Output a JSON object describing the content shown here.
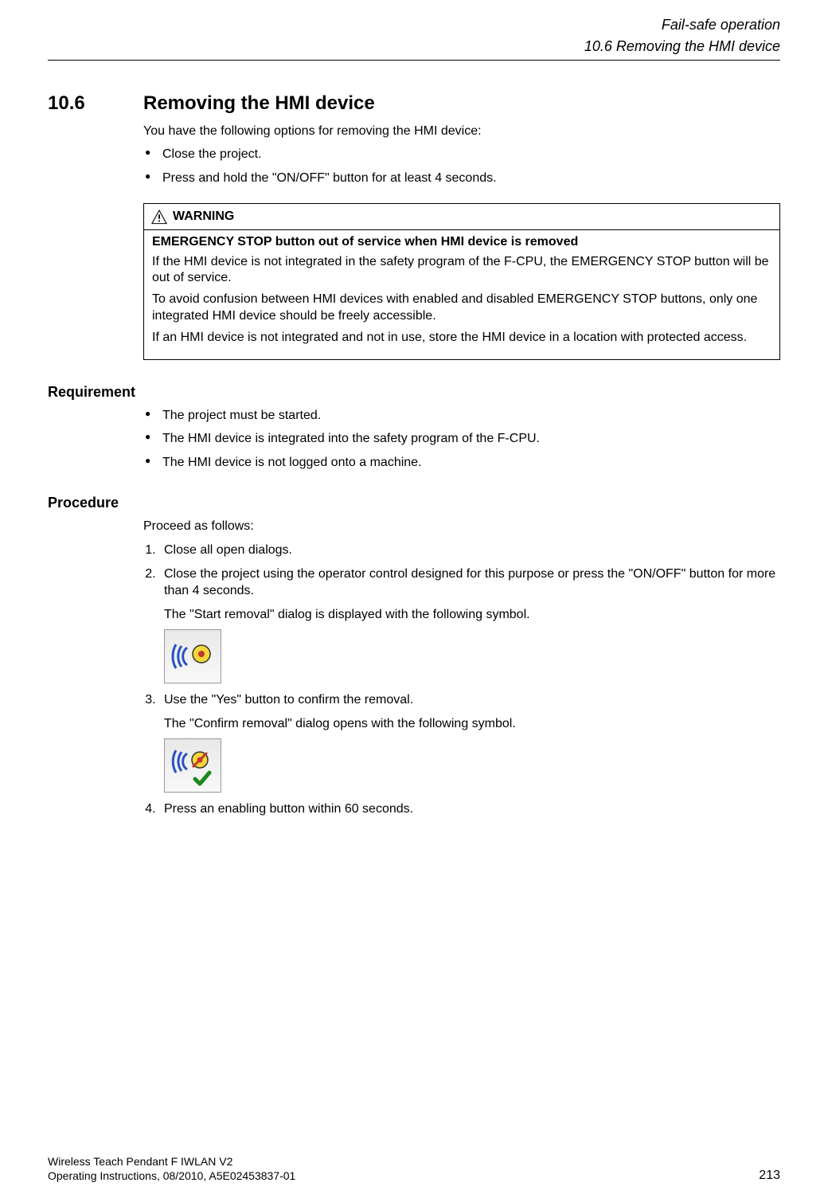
{
  "header": {
    "chapter": "Fail-safe operation",
    "section_path": "10.6 Removing the HMI device"
  },
  "section": {
    "number": "10.6",
    "title": "Removing the HMI device",
    "intro": "You have the following options for removing the HMI device:",
    "options": [
      "Close the project.",
      "Press and hold the \"ON/OFF\" button for at least 4 seconds."
    ]
  },
  "warning": {
    "label": "WARNING",
    "headline": "EMERGENCY STOP button out of service when HMI device is removed",
    "p1": "If the HMI device is not integrated in the safety program of the F-CPU, the EMERGENCY STOP button will be out of service.",
    "p2": "To avoid confusion between HMI devices with enabled and disabled EMERGENCY STOP buttons, only one integrated HMI device should be freely accessible.",
    "p3": "If an HMI device is not integrated and not in use, store the HMI device in a location with protected access."
  },
  "requirement": {
    "heading": "Requirement",
    "items": [
      "The project must be started.",
      "The HMI device is integrated into the safety program of the F-CPU.",
      "The HMI device is not logged onto a machine."
    ]
  },
  "procedure": {
    "heading": "Procedure",
    "lead": "Proceed as follows:",
    "step1": "Close all open dialogs.",
    "step2": "Close the project using the operator control designed for this purpose or press the \"ON/OFF\" button for more than 4 seconds.",
    "step2_after": "The \"Start removal\" dialog is displayed with the following symbol.",
    "step3": "Use the \"Yes\" button to confirm the removal.",
    "step3_after": "The \"Confirm removal\" dialog opens with the following symbol.",
    "step4": "Press an enabling button within 60 seconds."
  },
  "footer": {
    "line1": "Wireless Teach Pendant F IWLAN V2",
    "line2": "Operating Instructions, 08/2010, A5E02453837-01",
    "page": "213"
  }
}
